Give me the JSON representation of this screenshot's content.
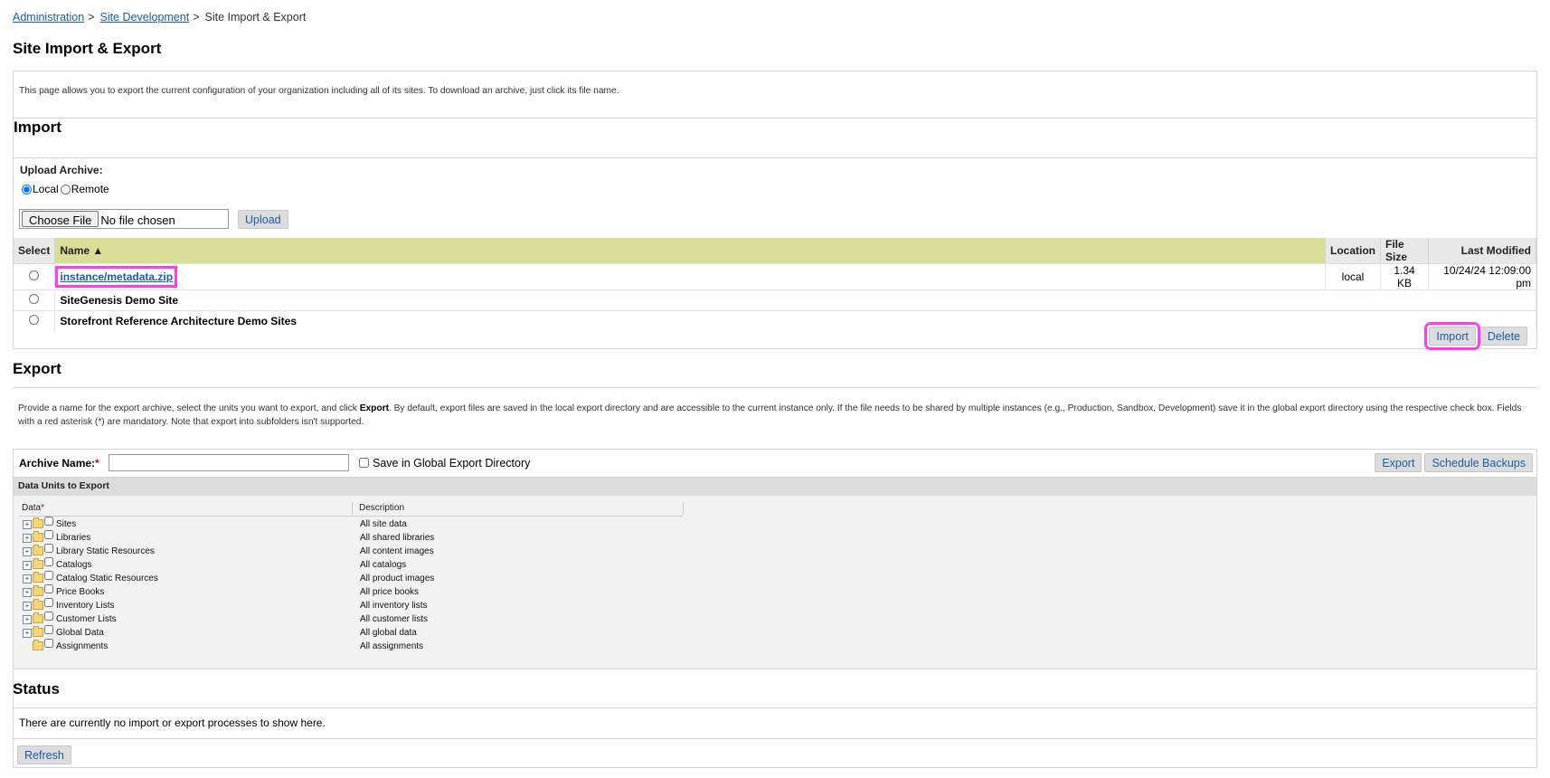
{
  "breadcrumb": {
    "items": [
      "Administration",
      "Site Development"
    ],
    "separator": ">",
    "current": "Site Import & Export"
  },
  "page_title": "Site Import & Export",
  "intro": "This page allows you to export the current configuration of your organization including all of its sites. To download an archive, just click its file name.",
  "import": {
    "heading": "Import",
    "upload_label": "Upload Archive:",
    "radio_local": "Local",
    "radio_remote": "Remote",
    "choose_file": "Choose File",
    "no_file": "No file chosen",
    "upload_button": "Upload",
    "columns": {
      "select": "Select",
      "name": "Name ▲",
      "location": "Location",
      "size": "File Size",
      "modified": "Last Modified"
    },
    "rows": [
      {
        "name": "instance/metadata.zip",
        "location": "local",
        "size": "1.34 KB",
        "modified": "10/24/24 12:09:00 pm"
      },
      {
        "name": "SiteGenesis Demo Site",
        "location": "",
        "size": "",
        "modified": ""
      },
      {
        "name": "Storefront Reference Architecture Demo Sites",
        "location": "",
        "size": "",
        "modified": ""
      }
    ],
    "import_button": "Import",
    "delete_button": "Delete"
  },
  "export": {
    "heading": "Export",
    "desc_before": "Provide a name for the export archive, select the units you want to export, and click ",
    "desc_bold": "Export",
    "desc_after": ". By default, export files are saved in the local export directory and are accessible to the current instance only. If the file needs to be shared by multiple instances (e.g., Production, Sandbox, Development) save it in the global export directory using the respective check box. Fields with a red asterisk (*) are mandatory. Note that export into subfolders isn't supported.",
    "archive_label": "Archive Name:",
    "req": "*",
    "archive_value": "",
    "global_label": "Save in Global Export Directory",
    "export_button": "Export",
    "schedule_button": "Schedule Backups",
    "units_header": "Data Units to Export",
    "col_data": "Data",
    "col_desc": "Description",
    "units": [
      {
        "name": "Sites",
        "desc": "All site data",
        "expandable": true
      },
      {
        "name": "Libraries",
        "desc": "All shared libraries",
        "expandable": true
      },
      {
        "name": "Library Static Resources",
        "desc": "All content images",
        "expandable": true
      },
      {
        "name": "Catalogs",
        "desc": "All catalogs",
        "expandable": true
      },
      {
        "name": "Catalog Static Resources",
        "desc": "All product images",
        "expandable": true
      },
      {
        "name": "Price Books",
        "desc": "All price books",
        "expandable": true
      },
      {
        "name": "Inventory Lists",
        "desc": "All inventory lists",
        "expandable": true
      },
      {
        "name": "Customer Lists",
        "desc": "All customer lists",
        "expandable": true
      },
      {
        "name": "Global Data",
        "desc": "All global data",
        "expandable": true
      },
      {
        "name": "Assignments",
        "desc": "All assignments",
        "expandable": false
      }
    ]
  },
  "status": {
    "heading": "Status",
    "message": "There are currently no import or export processes to show here.",
    "refresh_button": "Refresh"
  },
  "colors": {
    "link": "#1a5da6",
    "sorted_header": "#d8de98",
    "highlight": "#ff3cf0"
  }
}
